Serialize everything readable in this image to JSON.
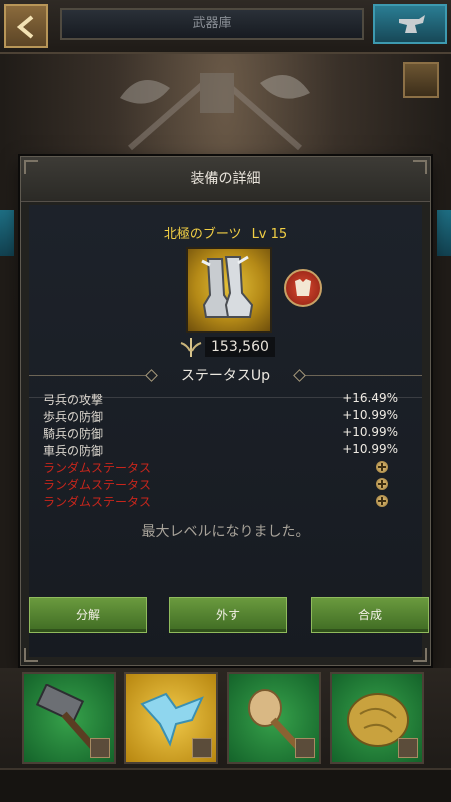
{
  "header": {
    "title": "武器庫"
  },
  "modal": {
    "title": "装備の詳細",
    "item": {
      "name": "北極のブーツ",
      "level": "Lv 15"
    },
    "power": "153,560",
    "section_title": "ステータスUp",
    "stats": [
      {
        "label": "弓兵の攻撃",
        "value": "+16.49%"
      },
      {
        "label": "歩兵の防御",
        "value": "+10.99%"
      },
      {
        "label": "騎兵の防御",
        "value": "+10.99%"
      },
      {
        "label": "車兵の防御",
        "value": "+10.99%"
      }
    ],
    "random_stats": [
      {
        "label": "ランダムステータス"
      },
      {
        "label": "ランダムステータス"
      },
      {
        "label": "ランダムステータス"
      }
    ],
    "max_level_message": "最大レベルになりました。",
    "buttons": {
      "dismantle": "分解",
      "remove": "外す",
      "combine": "合成"
    }
  },
  "colors": {
    "item_name": "#f1cf45",
    "random_stat": "#c8261c",
    "button_green": "#4f8230"
  },
  "tray": {
    "slots": [
      {
        "icon": "hammer-icon"
      },
      {
        "icon": "crystal-icon"
      },
      {
        "icon": "club-icon"
      },
      {
        "icon": "gold-ore-icon"
      }
    ]
  }
}
